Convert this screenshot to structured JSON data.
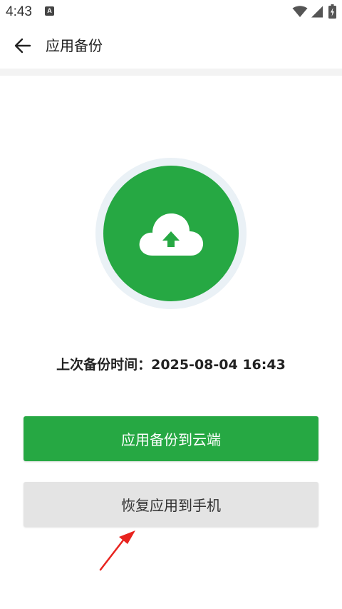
{
  "status_bar": {
    "time": "4:43",
    "notification_badge": "A",
    "icons": [
      "wifi-icon",
      "signal-icon",
      "battery-charging-icon"
    ]
  },
  "header": {
    "back_icon": "arrow-left-icon",
    "title": "应用备份"
  },
  "hero": {
    "icon": "cloud-upload-icon",
    "accent_color": "#26a843",
    "ring_color": "#eaf1f6"
  },
  "backup": {
    "last_time_text": "上次备份时间：2025-08-04 16:43"
  },
  "actions": {
    "backup_to_cloud_label": "应用备份到云端",
    "restore_to_phone_label": "恢复应用到手机"
  },
  "annotation": {
    "arrow_icon": "red-arrow-pointer",
    "arrow_color": "#e8241f"
  }
}
